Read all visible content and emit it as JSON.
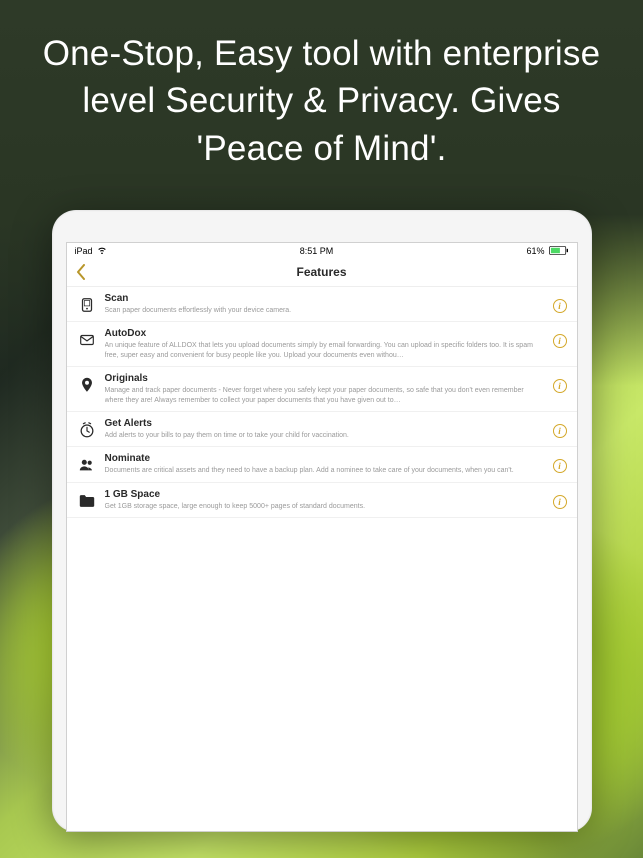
{
  "headline": "One-Stop, Easy tool with enterprise level Security & Privacy. Gives 'Peace of Mind'.",
  "status": {
    "device": "iPad",
    "time": "8:51 PM",
    "battery": "61%"
  },
  "nav": {
    "title": "Features"
  },
  "features": [
    {
      "title": "Scan",
      "desc": "Scan paper documents effortlessly with your device camera."
    },
    {
      "title": "AutoDox",
      "desc": "An unique feature of ALLDOX that lets you upload documents simply by email forwarding. You can upload in specific folders too. It is spam free, super easy and convenient for busy people like you. Upload your documents even withou…"
    },
    {
      "title": "Originals",
      "desc": "Manage and track paper documents - Never forget where you safely kept your paper documents, so safe that you don't even remember where they are! Always remember to collect your paper documents that you have given out to…"
    },
    {
      "title": "Get Alerts",
      "desc": "Add alerts to your bills to pay them on time or to take your child for vaccination."
    },
    {
      "title": "Nominate",
      "desc": "Documents are critical assets and they need to have a backup plan. Add a nominee to take care of your documents, when you can't."
    },
    {
      "title": "1 GB Space",
      "desc": "Get 1GB storage space, large enough to keep 5000+ pages of standard documents."
    }
  ],
  "info_label": "i"
}
